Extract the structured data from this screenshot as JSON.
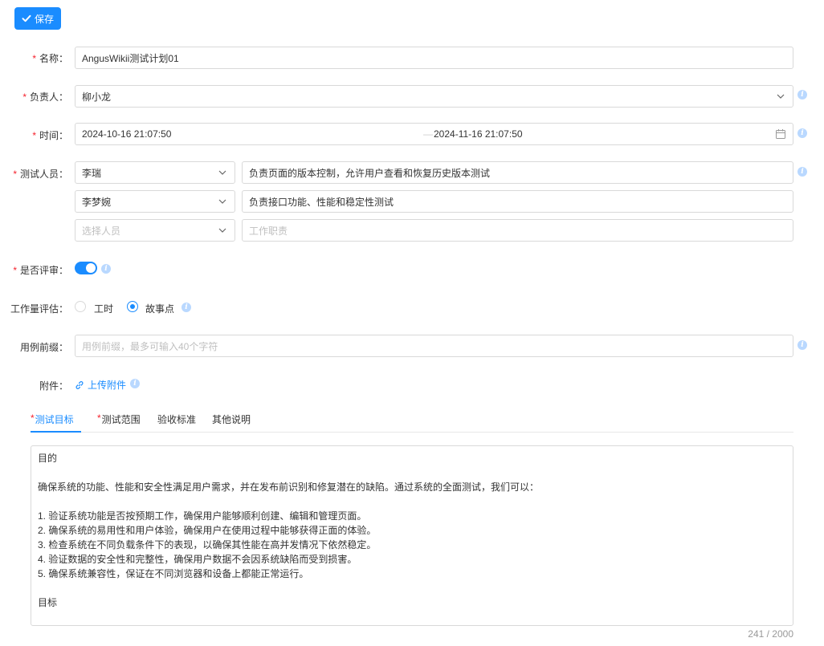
{
  "toolbar": {
    "save_label": "保存"
  },
  "form": {
    "name": {
      "label": "名称：",
      "value": "AngusWikii测试计划01"
    },
    "owner": {
      "label": "负责人：",
      "value": "柳小龙"
    },
    "time": {
      "label": "时间：",
      "start": "2024-10-16 21:07:50",
      "separator": "—",
      "end": "2024-11-16 21:07:50"
    },
    "testers": {
      "label": "测试人员：",
      "rows": [
        {
          "person": "李瑞",
          "duty": "负责页面的版本控制，允许用户查看和恢复历史版本测试"
        },
        {
          "person": "李梦婉",
          "duty": "负责接口功能、性能和稳定性测试"
        }
      ],
      "person_placeholder": "选择人员",
      "duty_placeholder": "工作职责"
    },
    "review": {
      "label": "是否评审：",
      "enabled": true
    },
    "estimate": {
      "label": "工作量评估：",
      "options": [
        "工时",
        "故事点"
      ],
      "selected": "故事点"
    },
    "prefix": {
      "label": "用例前缀：",
      "placeholder": "用例前缀，最多可输入40个字符"
    },
    "attachment": {
      "label": "附件：",
      "upload_label": "上传附件"
    }
  },
  "tabs": [
    {
      "label": "测试目标",
      "required": true,
      "active": true
    },
    {
      "label": "测试范围",
      "required": true,
      "active": false
    },
    {
      "label": "验收标准",
      "required": false,
      "active": false
    },
    {
      "label": "其他说明",
      "required": false,
      "active": false
    }
  ],
  "content": {
    "lines": [
      "目的",
      "",
      "确保系统的功能、性能和安全性满足用户需求，并在发布前识别和修复潜在的缺陷。通过系统的全面测试，我们可以：",
      "",
      "1. 验证系统功能是否按预期工作，确保用户能够顺利创建、编辑和管理页面。",
      "2. 确保系统的易用性和用户体验，确保用户在使用过程中能够获得正面的体验。",
      "3. 检查系统在不同负载条件下的表现，以确保其性能在高并发情况下依然稳定。",
      "4. 验证数据的安全性和完整性，确保用户数据不会因系统缺陷而受到损害。",
      "5. 确保系统兼容性，保证在不同浏览器和设备上都能正常运行。",
      "",
      "目标"
    ],
    "counter": "241 / 2000"
  },
  "colors": {
    "primary": "#1a8cff",
    "required": "#f5222d",
    "border": "#d9d9d9"
  },
  "icons": [
    "check-icon",
    "chevron-down-icon",
    "calendar-icon",
    "info-icon",
    "link-icon"
  ]
}
